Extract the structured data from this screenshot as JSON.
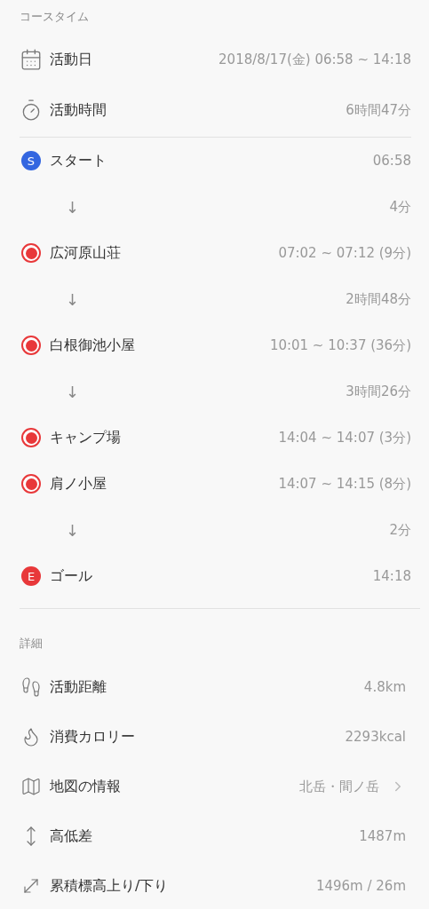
{
  "course_time": {
    "header": "コースタイム",
    "summary": [
      {
        "label": "活動日",
        "value": "2018/8/17(金) 06:58 ~ 14:18"
      },
      {
        "label": "活動時間",
        "value": "6時間47分"
      }
    ],
    "timeline": [
      {
        "kind": "start",
        "badge": "S",
        "color": "#3366e0",
        "label": "スタート",
        "value": "06:58"
      },
      {
        "kind": "segment",
        "arrow": "↓",
        "value": "4分"
      },
      {
        "kind": "waypoint",
        "color": "#e8383a",
        "label": "広河原山荘",
        "value": "07:02 ~ 07:12 (9分)"
      },
      {
        "kind": "segment",
        "arrow": "↓",
        "value": "2時間48分"
      },
      {
        "kind": "waypoint",
        "color": "#e8383a",
        "label": "白根御池小屋",
        "value": "10:01 ~ 10:37 (36分)"
      },
      {
        "kind": "segment",
        "arrow": "↓",
        "value": "3時間26分"
      },
      {
        "kind": "waypoint",
        "color": "#e8383a",
        "label": "キャンプ場",
        "value": "14:04 ~ 14:07 (3分)"
      },
      {
        "kind": "waypoint",
        "color": "#e8383a",
        "label": "肩ノ小屋",
        "value": "14:07 ~ 14:15 (8分)"
      },
      {
        "kind": "segment",
        "arrow": "↓",
        "value": "2分"
      },
      {
        "kind": "goal",
        "badge": "E",
        "color": "#e8383a",
        "label": "ゴール",
        "value": "14:18"
      }
    ]
  },
  "details": {
    "header": "詳細",
    "rows": [
      {
        "label": "活動距離",
        "value": "4.8km",
        "link": false
      },
      {
        "label": "消費カロリー",
        "value": "2293kcal",
        "link": false
      },
      {
        "label": "地図の情報",
        "value": "北岳・間ノ岳",
        "link": true
      },
      {
        "label": "高低差",
        "value": "1487m",
        "link": false
      },
      {
        "label": "累積標高上り/下り",
        "value": "1496m / 26m",
        "link": false
      }
    ]
  }
}
